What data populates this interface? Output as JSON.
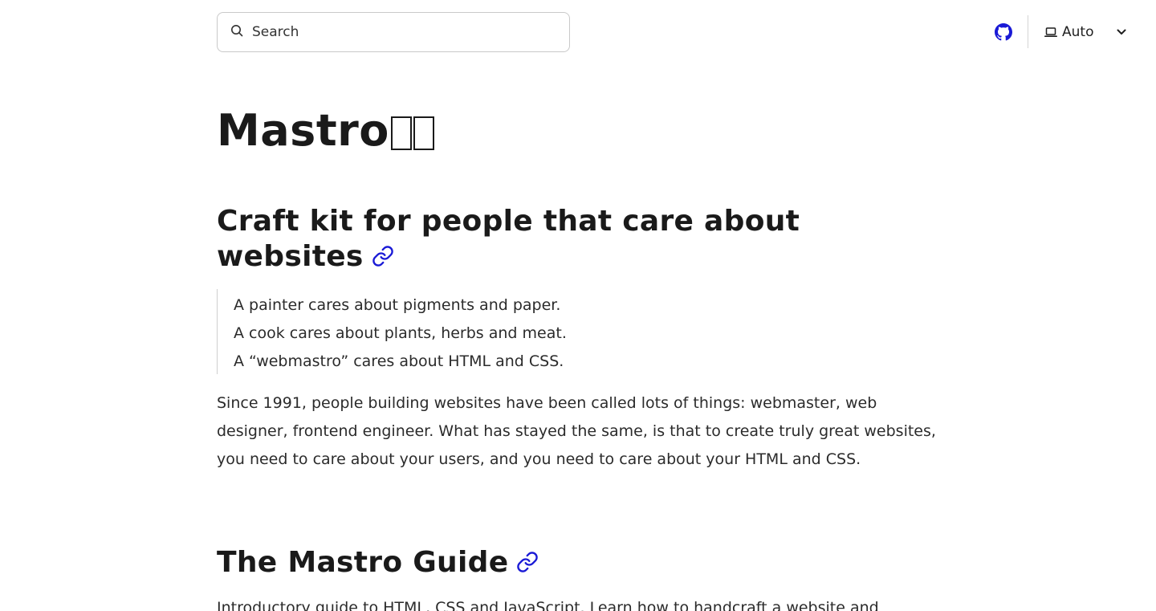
{
  "header": {
    "search": {
      "placeholder": "Search"
    },
    "github": {
      "label": "GitHub"
    },
    "theme": {
      "selected": "Auto"
    }
  },
  "colors": {
    "accent": "#1a1ad6",
    "text": "#1f1f1f",
    "muted_border": "#c9c9c9"
  },
  "main": {
    "title": "Mastro",
    "sections": [
      {
        "heading": "Craft kit for people that care about websites",
        "quote_lines": [
          "A painter cares about pigments and paper.",
          "A cook cares about plants, herbs and meat.",
          "A “webmastro” cares about HTML and CSS."
        ],
        "paragraph": "Since 1991, people building websites have been called lots of things: webmaster, web designer, frontend engineer. What has stayed the same, is that to create truly great websites, you need to care about your users, and you need to care about your HTML and CSS."
      },
      {
        "heading": "The Mastro Guide",
        "paragraph": "Introductory guide to HTML, CSS and JavaScript. Learn how to handcraft a website and"
      }
    ]
  },
  "icons": [
    "search-icon",
    "github-icon",
    "laptop-icon",
    "chevron-down-icon",
    "link-icon"
  ]
}
